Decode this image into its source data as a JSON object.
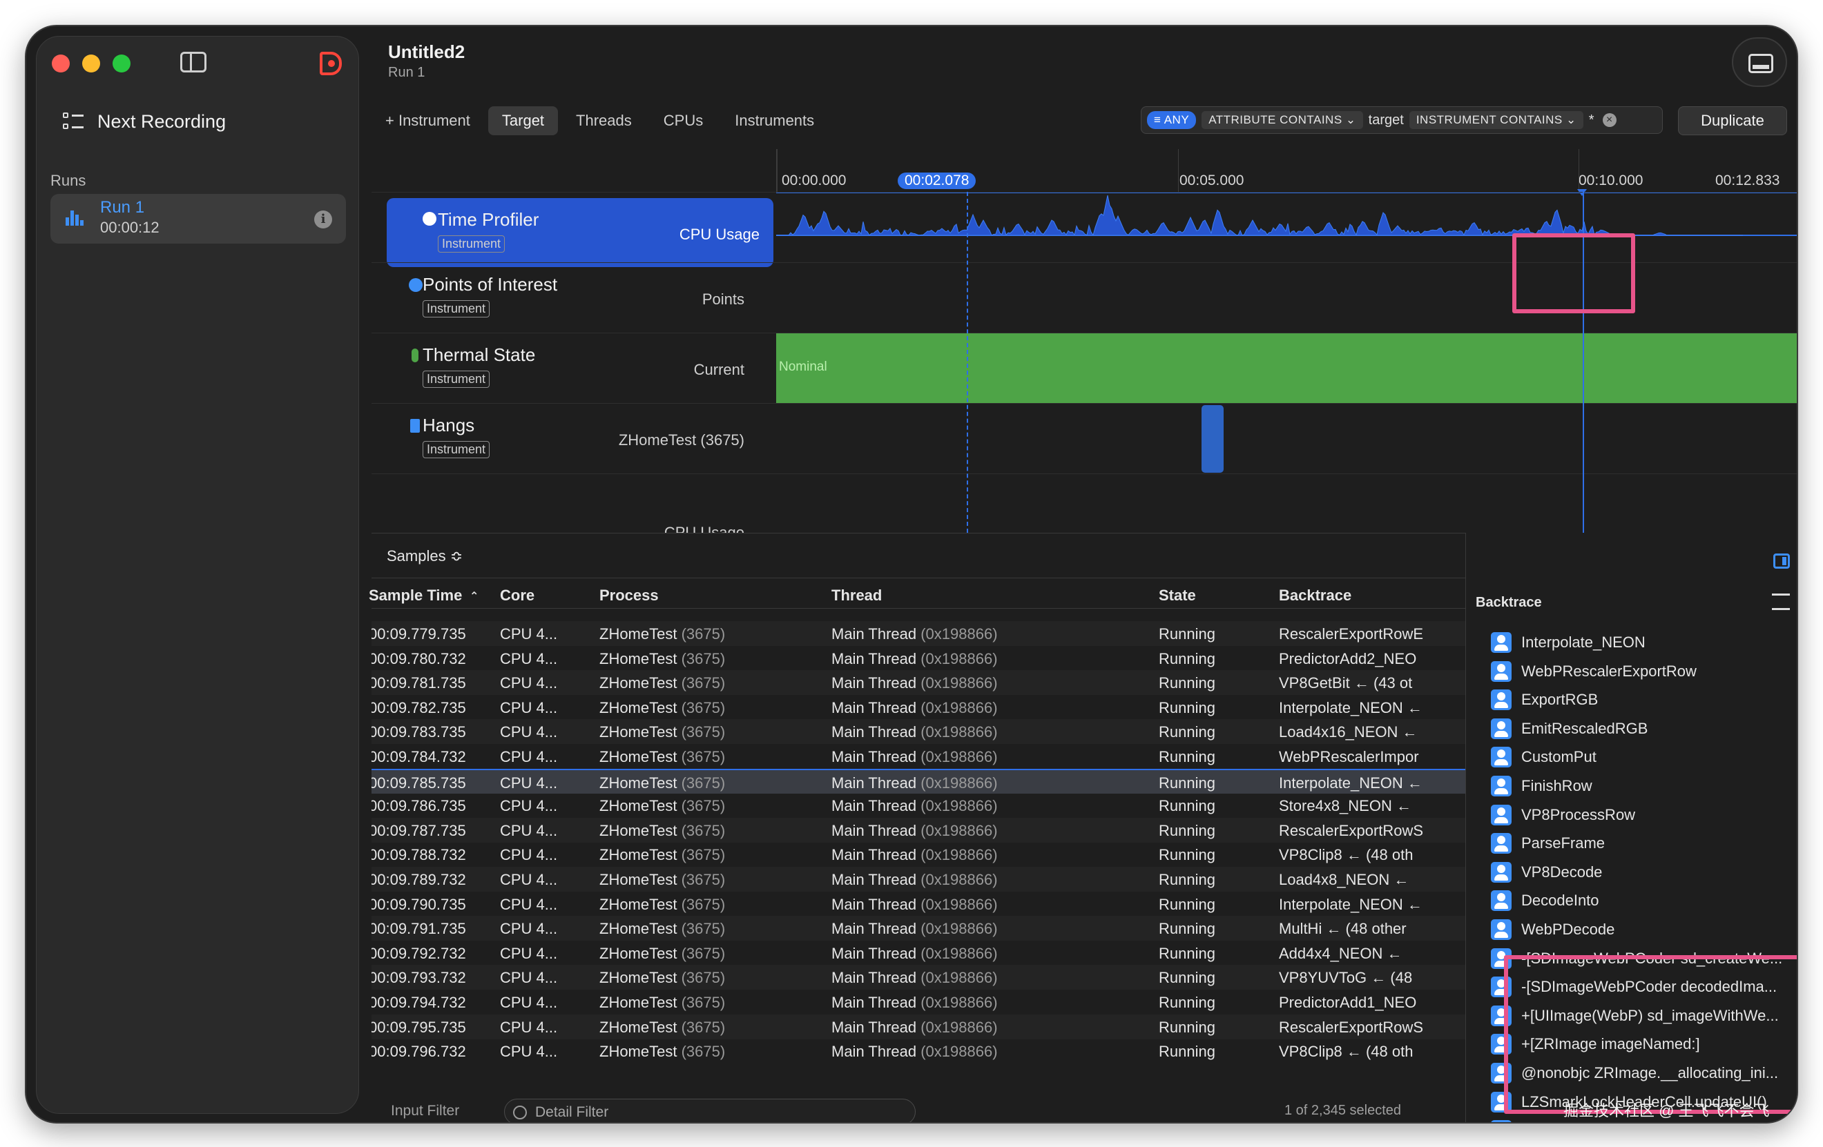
{
  "window": {
    "title": "Untitled2",
    "subtitle": "Run 1"
  },
  "sidebar": {
    "next_recording": "Next Recording",
    "runs_label": "Runs",
    "run": {
      "title": "Run 1",
      "time": "00:00:12"
    }
  },
  "toolbar": {
    "add_instrument": "+ Instrument",
    "tabs": [
      "Target",
      "Threads",
      "CPUs",
      "Instruments"
    ],
    "filter": {
      "any": "ANY",
      "attr": "ATTRIBUTE CONTAINS",
      "value": "target",
      "instr": "INSTRUMENT CONTAINS",
      "star": "*"
    },
    "duplicate": "Duplicate"
  },
  "ruler": {
    "t0": "00:00.000",
    "t1": "00:02.078",
    "t2": "00:05.000",
    "t3": "00:10.000",
    "t4": "00:12.833"
  },
  "tracks": [
    {
      "name": "Time Profiler",
      "badge": "Instrument",
      "type": "CPU Usage",
      "color": "#2755cf"
    },
    {
      "name": "Points of Interest",
      "badge": "Instrument",
      "type": "Points"
    },
    {
      "name": "Thermal State",
      "badge": "Instrument",
      "type": "Current",
      "state": "Nominal",
      "color": "#4ea447"
    },
    {
      "name": "Hangs",
      "badge": "Instrument",
      "type": "ZHomeTest (3675)"
    },
    {
      "type": "CPU Usage"
    }
  ],
  "samples": {
    "label": "Samples ≎",
    "columns": [
      "Sample Time",
      "Core",
      "Process",
      "Thread",
      "State",
      "Backtrace"
    ],
    "rows": [
      {
        "time": "00:09.779.735",
        "core": "CPU 4...",
        "proc": "ZHomeTest",
        "pid": "(3675)",
        "thread": "Main Thread",
        "tid": "(0x198866)",
        "state": "Running",
        "bt": "RescalerExportRowE"
      },
      {
        "time": "00:09.780.732",
        "core": "CPU 4...",
        "proc": "ZHomeTest",
        "pid": "(3675)",
        "thread": "Main Thread",
        "tid": "(0x198866)",
        "state": "Running",
        "bt": "PredictorAdd2_NEO"
      },
      {
        "time": "00:09.781.735",
        "core": "CPU 4...",
        "proc": "ZHomeTest",
        "pid": "(3675)",
        "thread": "Main Thread",
        "tid": "(0x198866)",
        "state": "Running",
        "bt": "VP8GetBit ← (43 ot"
      },
      {
        "time": "00:09.782.735",
        "core": "CPU 4...",
        "proc": "ZHomeTest",
        "pid": "(3675)",
        "thread": "Main Thread",
        "tid": "(0x198866)",
        "state": "Running",
        "bt": "Interpolate_NEON ←"
      },
      {
        "time": "00:09.783.735",
        "core": "CPU 4...",
        "proc": "ZHomeTest",
        "pid": "(3675)",
        "thread": "Main Thread",
        "tid": "(0x198866)",
        "state": "Running",
        "bt": "Load4x16_NEON ←"
      },
      {
        "time": "00:09.784.732",
        "core": "CPU 4...",
        "proc": "ZHomeTest",
        "pid": "(3675)",
        "thread": "Main Thread",
        "tid": "(0x198866)",
        "state": "Running",
        "bt": "WebPRescalerImpor"
      },
      {
        "time": "00:09.785.735",
        "core": "CPU 4...",
        "proc": "ZHomeTest",
        "pid": "(3675)",
        "thread": "Main Thread",
        "tid": "(0x198866)",
        "state": "Running",
        "bt": "Interpolate_NEON ←"
      },
      {
        "time": "00:09.786.735",
        "core": "CPU 4...",
        "proc": "ZHomeTest",
        "pid": "(3675)",
        "thread": "Main Thread",
        "tid": "(0x198866)",
        "state": "Running",
        "bt": "Store4x8_NEON ←"
      },
      {
        "time": "00:09.787.735",
        "core": "CPU 4...",
        "proc": "ZHomeTest",
        "pid": "(3675)",
        "thread": "Main Thread",
        "tid": "(0x198866)",
        "state": "Running",
        "bt": "RescalerExportRowS"
      },
      {
        "time": "00:09.788.732",
        "core": "CPU 4...",
        "proc": "ZHomeTest",
        "pid": "(3675)",
        "thread": "Main Thread",
        "tid": "(0x198866)",
        "state": "Running",
        "bt": "VP8Clip8 ← (48 oth"
      },
      {
        "time": "00:09.789.732",
        "core": "CPU 4...",
        "proc": "ZHomeTest",
        "pid": "(3675)",
        "thread": "Main Thread",
        "tid": "(0x198866)",
        "state": "Running",
        "bt": "Load4x8_NEON ←"
      },
      {
        "time": "00:09.790.735",
        "core": "CPU 4...",
        "proc": "ZHomeTest",
        "pid": "(3675)",
        "thread": "Main Thread",
        "tid": "(0x198866)",
        "state": "Running",
        "bt": "Interpolate_NEON ←"
      },
      {
        "time": "00:09.791.735",
        "core": "CPU 4...",
        "proc": "ZHomeTest",
        "pid": "(3675)",
        "thread": "Main Thread",
        "tid": "(0x198866)",
        "state": "Running",
        "bt": "MultHi ← (48 other"
      },
      {
        "time": "00:09.792.732",
        "core": "CPU 4...",
        "proc": "ZHomeTest",
        "pid": "(3675)",
        "thread": "Main Thread",
        "tid": "(0x198866)",
        "state": "Running",
        "bt": "Add4x4_NEON ←"
      },
      {
        "time": "00:09.793.732",
        "core": "CPU 4...",
        "proc": "ZHomeTest",
        "pid": "(3675)",
        "thread": "Main Thread",
        "tid": "(0x198866)",
        "state": "Running",
        "bt": "VP8YUVToG ← (48"
      },
      {
        "time": "00:09.794.732",
        "core": "CPU 4...",
        "proc": "ZHomeTest",
        "pid": "(3675)",
        "thread": "Main Thread",
        "tid": "(0x198866)",
        "state": "Running",
        "bt": "PredictorAdd1_NEO"
      },
      {
        "time": "00:09.795.735",
        "core": "CPU 4...",
        "proc": "ZHomeTest",
        "pid": "(3675)",
        "thread": "Main Thread",
        "tid": "(0x198866)",
        "state": "Running",
        "bt": "RescalerExportRowS"
      },
      {
        "time": "00:09.796.732",
        "core": "CPU 4...",
        "proc": "ZHomeTest",
        "pid": "(3675)",
        "thread": "Main Thread",
        "tid": "(0x198866)",
        "state": "Running",
        "bt": "VP8Clip8 ← (48 oth"
      }
    ]
  },
  "bottom": {
    "input_filter": "Input Filter",
    "detail_filter": "Detail Filter",
    "selected": "1 of 2,345 selected"
  },
  "backtrace": {
    "title": "Backtrace",
    "items": [
      "Interpolate_NEON",
      "WebPRescalerExportRow",
      "ExportRGB",
      "EmitRescaledRGB",
      "CustomPut",
      "FinishRow",
      "VP8ProcessRow",
      "ParseFrame",
      "VP8Decode",
      "DecodeInto",
      "WebPDecode",
      "-[SDImageWebPCoder sd_createWe...",
      "-[SDImageWebPCoder decodedIma...",
      "+[UIImage(WebP) sd_imageWithWe...",
      "+[ZRImage imageNamed:]",
      "@nonobjc ZRImage.__allocating_ini...",
      "LZSmarkLockHeaderCell.updateUI()",
      "LZSmarkL"
    ]
  },
  "watermark": "掘金技术社区 @ 王飞飞不会飞"
}
